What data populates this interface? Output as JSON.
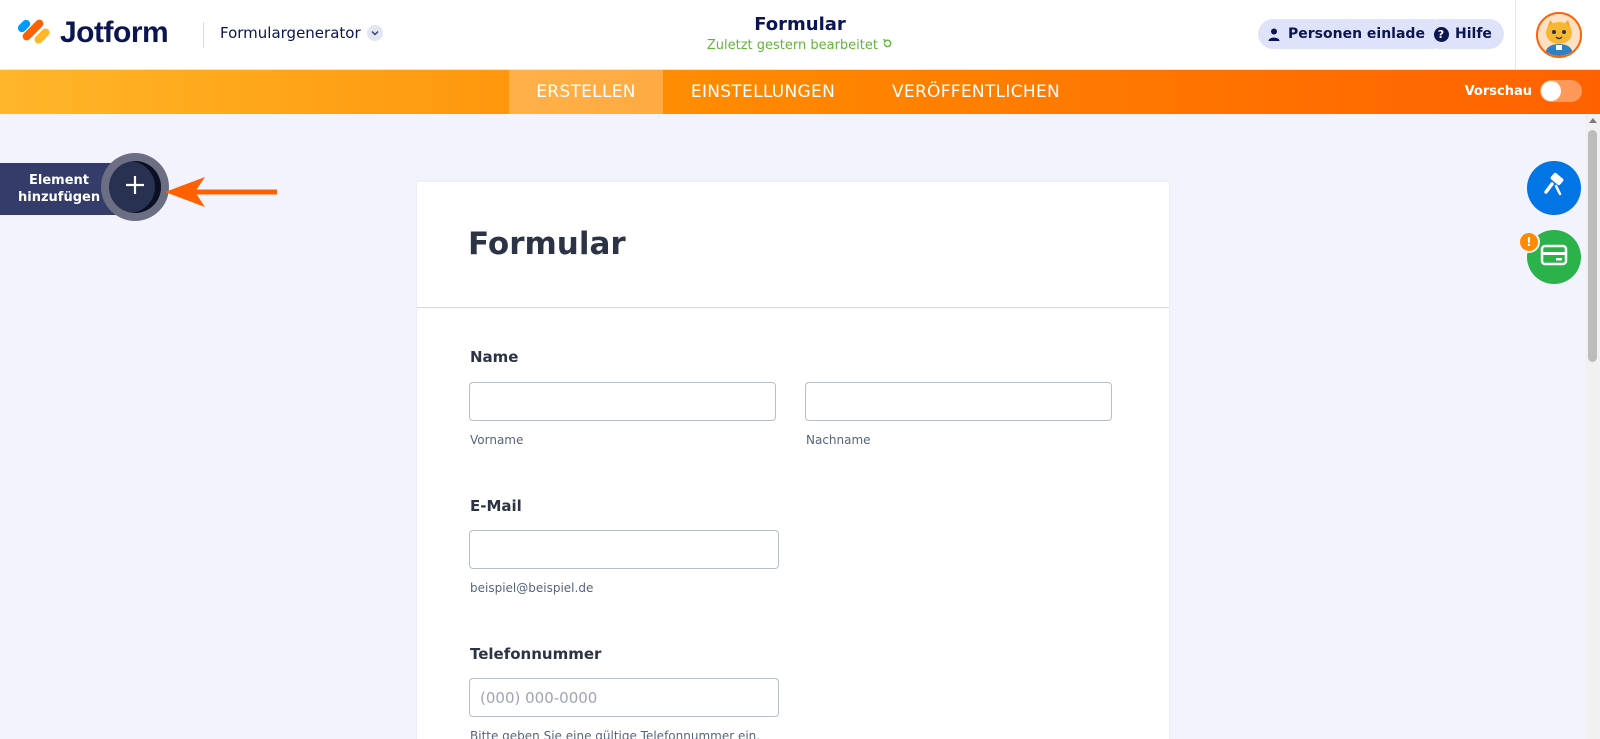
{
  "header": {
    "logo_text": "Jotform",
    "builder_label": "Formulargenerator",
    "form_title": "Formular",
    "last_edited": "Zuletzt gestern bearbeitet",
    "invite_label": "Personen einladen",
    "help_label": "Hilfe"
  },
  "tabs": [
    {
      "label": "ERSTELLEN",
      "active": true
    },
    {
      "label": "EINSTELLUNGEN",
      "active": false
    },
    {
      "label": "VERÖFFENTLICHEN",
      "active": false
    }
  ],
  "preview": {
    "label": "Vorschau",
    "on": false
  },
  "add_element": {
    "line1": "Element",
    "line2": "hinzufügen"
  },
  "notification_badge": "!",
  "form": {
    "title": "Formular",
    "name_label": "Name",
    "first_name_sublabel": "Vorname",
    "last_name_sublabel": "Nachname",
    "email_label": "E-Mail",
    "email_sublabel": "beispiel@beispiel.de",
    "phone_label": "Telefonnummer",
    "phone_placeholder": "(000) 000-0000",
    "phone_sublabel": "Bitte geben Sie eine gültige Telefonnummer ein."
  },
  "colors": {
    "accent_orange": "#ff6100",
    "tab_gradient_start": "#ffb629",
    "navy": "#0a1551",
    "edited_green": "#64b33d",
    "fab_blue": "#0075e3",
    "fab_green": "#2bb24a"
  },
  "icons": [
    "jotform-logo-icon",
    "chevron-down-icon",
    "refresh-icon",
    "user-icon",
    "help-icon",
    "plus-icon",
    "arrow-left-icon",
    "paint-roller-icon",
    "credit-card-icon"
  ]
}
